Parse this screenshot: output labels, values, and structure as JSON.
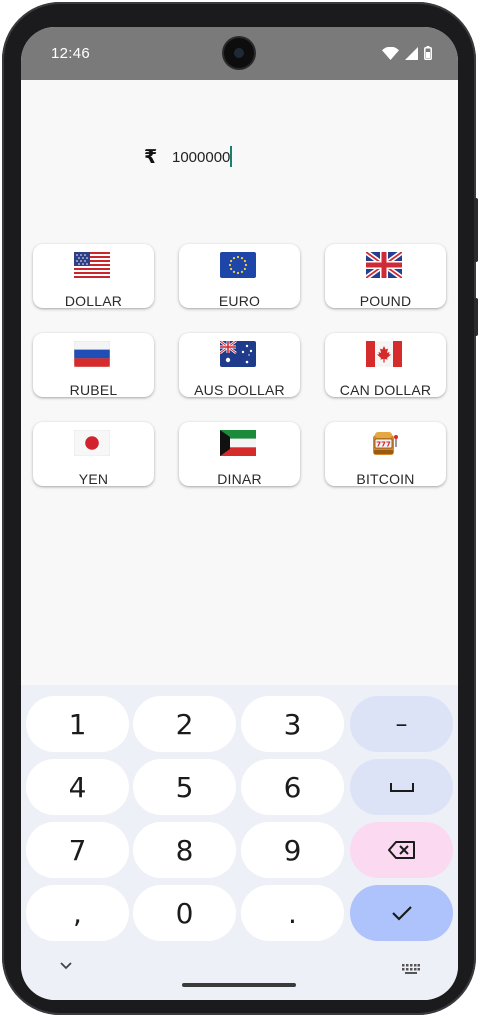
{
  "status": {
    "time": "12:46"
  },
  "amount": {
    "currency_symbol": "₹",
    "value": "1000000"
  },
  "currencies": [
    {
      "label": "DOLLAR",
      "flag": "us-flag-icon"
    },
    {
      "label": "EURO",
      "flag": "eu-flag-icon"
    },
    {
      "label": "POUND",
      "flag": "uk-flag-icon"
    },
    {
      "label": "RUBEL",
      "flag": "russia-flag-icon"
    },
    {
      "label": "AUS DOLLAR",
      "flag": "australia-flag-icon"
    },
    {
      "label": "CAN DOLLAR",
      "flag": "canada-flag-icon"
    },
    {
      "label": "YEN",
      "flag": "japan-flag-icon"
    },
    {
      "label": "DINAR",
      "flag": "kuwait-flag-icon"
    },
    {
      "label": "BITCOIN",
      "flag": "slot-machine-icon"
    }
  ],
  "keyboard": {
    "keys": [
      "1",
      "2",
      "3",
      "–",
      "4",
      "5",
      "6",
      "␣",
      "7",
      "8",
      "9",
      "⌫",
      ",",
      "0",
      ".",
      "✓"
    ]
  },
  "colors": {
    "status_bar": "#7a7a7a",
    "keyboard_bg": "#eef0f7",
    "confirm_key": "#aec3fb",
    "delete_key": "#fbd9f1"
  }
}
